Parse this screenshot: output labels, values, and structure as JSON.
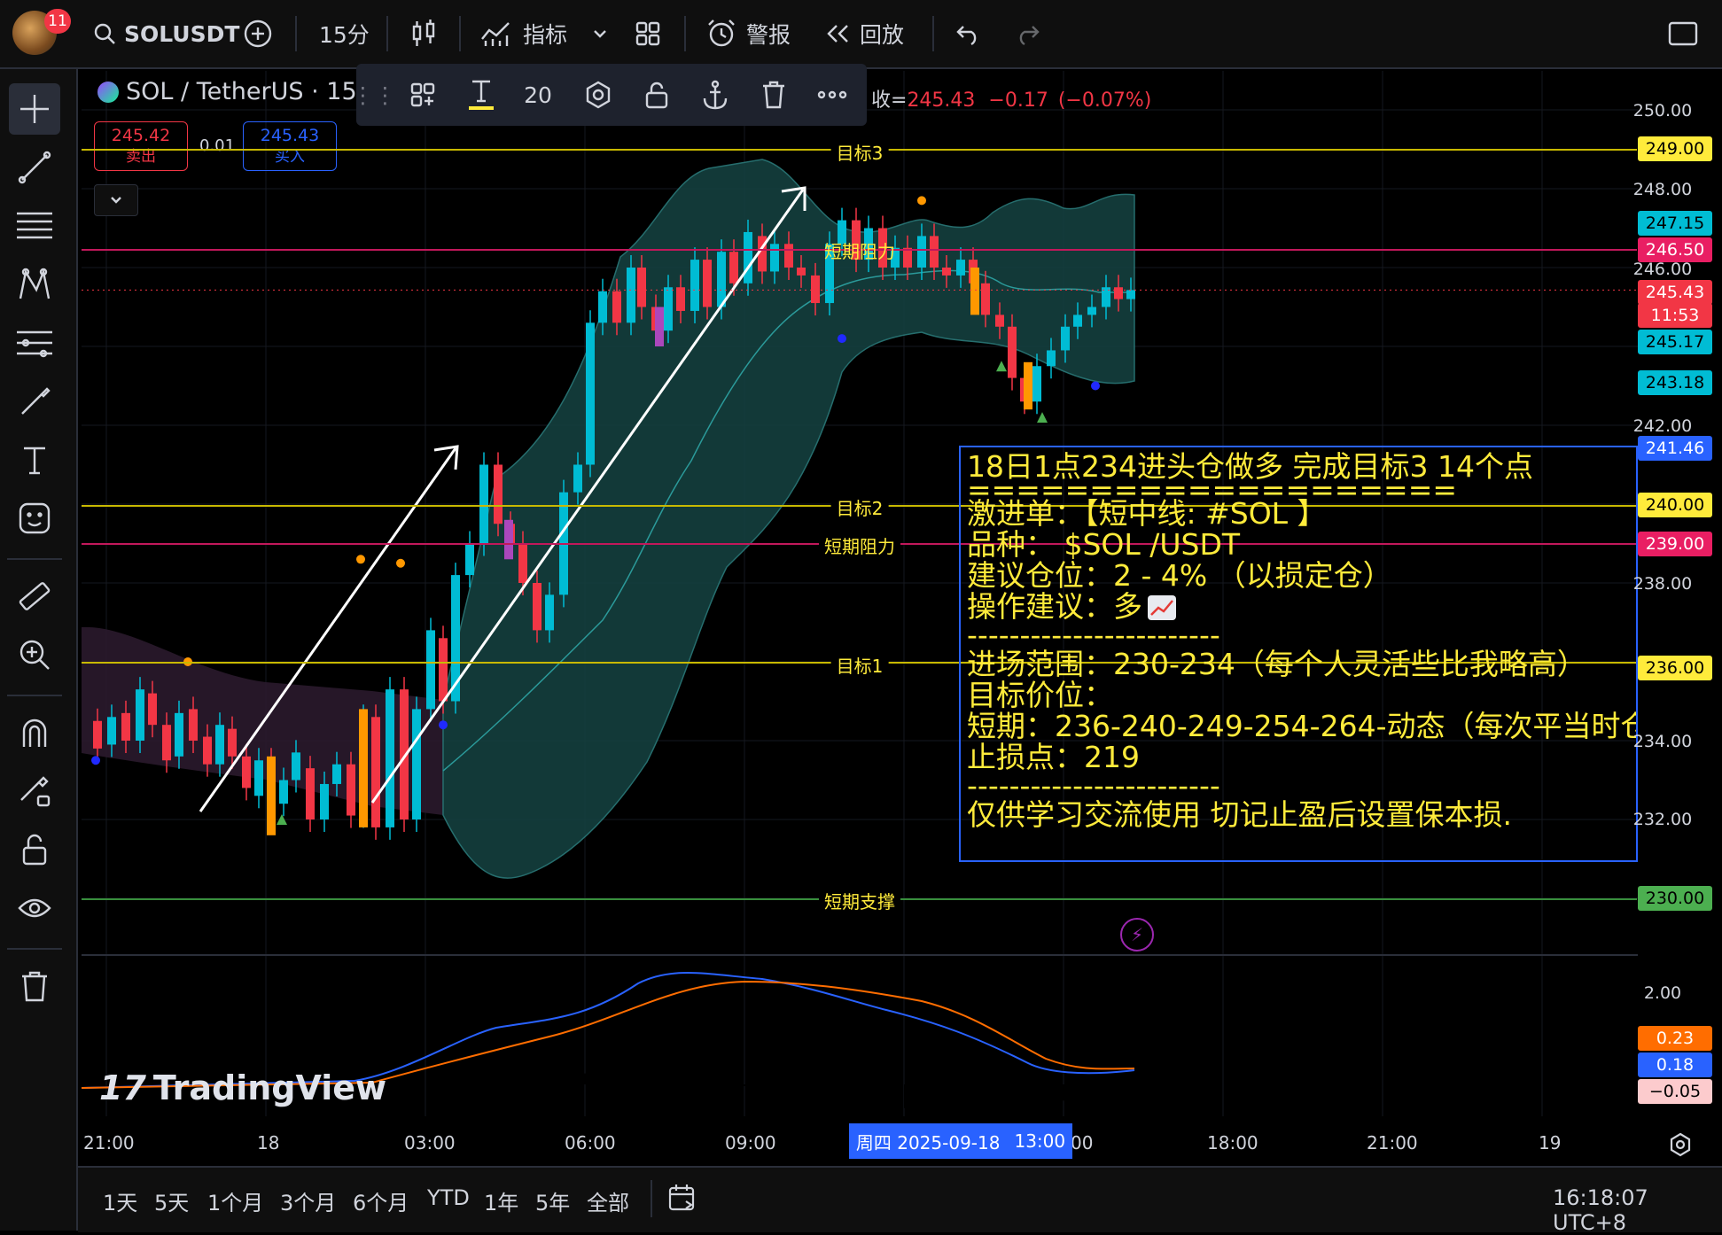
{
  "topbar": {
    "notification_count": "11",
    "symbol": "SOLUSDT",
    "interval": "15分",
    "indicators_label": "指标",
    "alert_label": "警报",
    "replay_label": "回放"
  },
  "legend": {
    "pair": "SOL / TetherUS · 15 ·",
    "close_prefix": "收=",
    "close": "245.43",
    "change": "−0.17",
    "change_pct": "(−0.07%)"
  },
  "drawing_toolbar": {
    "font_size": "20"
  },
  "trade": {
    "sell_price": "245.42",
    "sell_label": "卖出",
    "spread": "0.01",
    "buy_price": "245.43",
    "buy_label": "买入"
  },
  "price_axis": {
    "labels": [
      "250.00",
      "248.00",
      "246.00",
      "242.00",
      "238.00",
      "234.00",
      "232.00"
    ],
    "macd_label": "2.00"
  },
  "price_tags": [
    {
      "text": "249.00",
      "bg": "#ffeb3b",
      "fg": "#000000"
    },
    {
      "text": "247.15",
      "bg": "#00bcd4",
      "fg": "#000000"
    },
    {
      "text": "246.50",
      "bg": "#e91e63",
      "fg": "#ffffff"
    },
    {
      "text": "245.43",
      "bg": "#f23645",
      "fg": "#ffffff"
    },
    {
      "text": "11:53",
      "bg": "#f23645",
      "fg": "#ffffff"
    },
    {
      "text": "245.17",
      "bg": "#00bcd4",
      "fg": "#000000"
    },
    {
      "text": "243.18",
      "bg": "#00bcd4",
      "fg": "#000000"
    },
    {
      "text": "241.46",
      "bg": "#2962ff",
      "fg": "#ffffff"
    },
    {
      "text": "240.00",
      "bg": "#ffeb3b",
      "fg": "#000000"
    },
    {
      "text": "239.00",
      "bg": "#e91e63",
      "fg": "#ffffff"
    },
    {
      "text": "236.00",
      "bg": "#ffeb3b",
      "fg": "#000000"
    },
    {
      "text": "230.00",
      "bg": "#4caf50",
      "fg": "#000000"
    },
    {
      "text": "0.23",
      "bg": "#ff6d00",
      "fg": "#ffffff"
    },
    {
      "text": "0.18",
      "bg": "#2962ff",
      "fg": "#ffffff"
    },
    {
      "text": "−0.05",
      "bg": "#fccbcd",
      "fg": "#000000"
    }
  ],
  "levels": [
    {
      "label": "目标3",
      "color": "#c8b900"
    },
    {
      "label": "短期阻力",
      "color": "#c2185b"
    },
    {
      "label": "目标2",
      "color": "#c8b900"
    },
    {
      "label": "短期阻力",
      "color": "#c2185b"
    },
    {
      "label": "目标1",
      "color": "#c8b900"
    },
    {
      "label": "短期支撑",
      "color": "#388e3c"
    }
  ],
  "note": {
    "lines": [
      "18日1点234进头仓做多 完成目标3 14个点",
      "====================",
      "激进单：【短中线: #SOL 】",
      "品种： $SOL /USDT",
      "建议仓位：2 - 4% （以损定仓）",
      "操作建议：多",
      "------------------------",
      "进场范围：230-234（每个人灵活些比我略高）",
      "目标价位：",
      "短期：236-240-249-254-264-动态（每次平当时仓",
      "止损点：219",
      "------------------------",
      "仅供学习交流使用 切记止盈后设置保本损."
    ]
  },
  "watermark": "TradingView",
  "time_axis": {
    "labels": [
      "21:00",
      "18",
      "03:00",
      "06:00",
      "09:00",
      "00",
      "18:00",
      "21:00",
      "19"
    ],
    "crosshair_date": "周四 2025-09-18",
    "crosshair_time": "13:00"
  },
  "bottombar": {
    "ranges": [
      "1天",
      "5天",
      "1个月",
      "3个月",
      "6个月",
      "YTD",
      "1年",
      "5年",
      "全部"
    ],
    "clock": "16:18:07 UTC+8"
  },
  "colors": {
    "up": "#00bcd4",
    "down": "#f23645",
    "band_fill": "#14403f",
    "macd_line": "#2962ff",
    "signal_line": "#ff6d00"
  }
}
